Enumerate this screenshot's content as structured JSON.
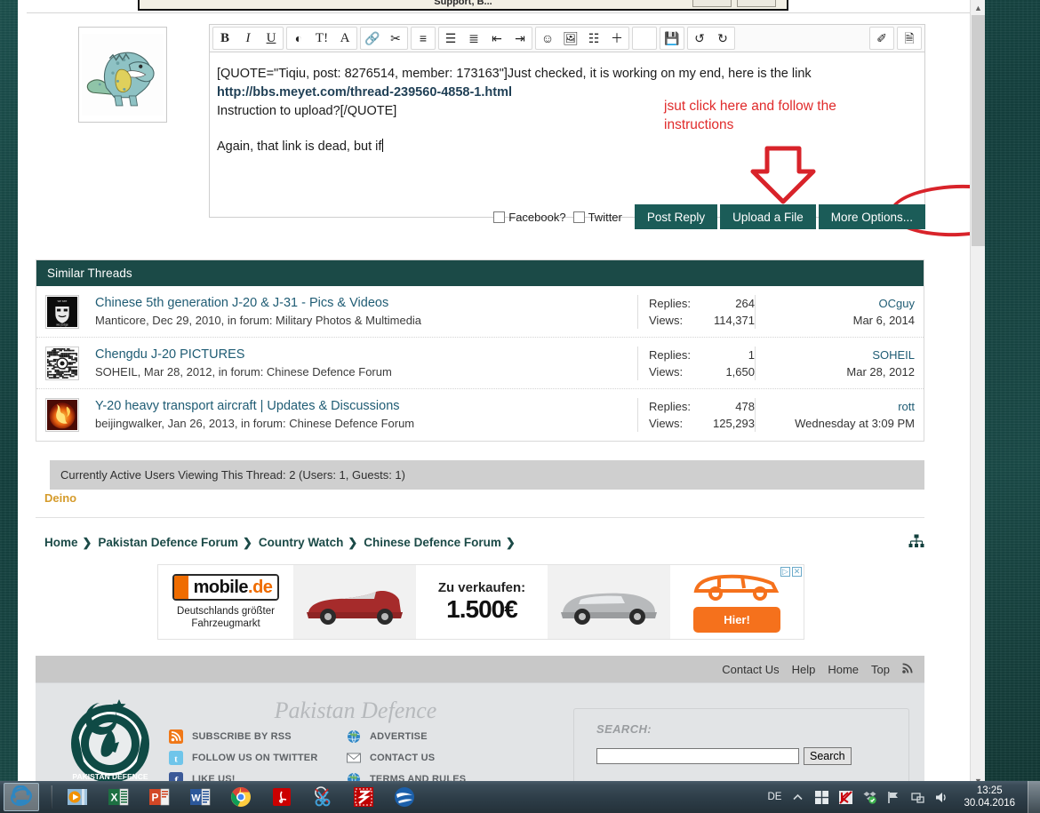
{
  "top_dialog": {
    "title": "Support, B..."
  },
  "editor": {
    "toolbar_groups": [
      {
        "buttons": [
          {
            "name": "bold-icon",
            "glyph": "B",
            "style": "b-bold"
          },
          {
            "name": "italic-icon",
            "glyph": "I",
            "style": "b-ital"
          },
          {
            "name": "underline-icon",
            "glyph": "U",
            "style": "b-under"
          }
        ]
      },
      {
        "buttons": [
          {
            "name": "text-color-icon",
            "glyph": "◐",
            "style": ""
          },
          {
            "name": "font-size-icon",
            "glyph": "T!",
            "style": "b-serif"
          },
          {
            "name": "font-family-icon",
            "glyph": "A",
            "style": "b-serif"
          }
        ]
      },
      {
        "buttons": [
          {
            "name": "insert-link-icon",
            "glyph": "🔗",
            "style": ""
          },
          {
            "name": "unlink-icon",
            "glyph": "✂",
            "style": ""
          }
        ]
      },
      {
        "buttons": [
          {
            "name": "align-icon",
            "glyph": "≡",
            "style": ""
          }
        ]
      },
      {
        "buttons": [
          {
            "name": "bullet-list-icon",
            "glyph": "☰",
            "style": ""
          },
          {
            "name": "numbered-list-icon",
            "glyph": "≣",
            "style": ""
          },
          {
            "name": "outdent-icon",
            "glyph": "⇤",
            "style": ""
          },
          {
            "name": "indent-icon",
            "glyph": "⇥",
            "style": ""
          }
        ]
      },
      {
        "buttons": [
          {
            "name": "smilie-icon",
            "glyph": "☺",
            "style": ""
          },
          {
            "name": "insert-image-icon",
            "glyph": "🖼",
            "style": ""
          },
          {
            "name": "insert-media-icon",
            "glyph": "☷",
            "style": ""
          },
          {
            "name": "more-tools-icon",
            "glyph": "＋",
            "style": ""
          }
        ]
      },
      {
        "empty": true
      },
      {
        "buttons": [
          {
            "name": "save-draft-icon",
            "glyph": "💾",
            "style": ""
          }
        ]
      },
      {
        "buttons": [
          {
            "name": "undo-icon",
            "glyph": "↺",
            "style": ""
          },
          {
            "name": "redo-icon",
            "glyph": "↻",
            "style": ""
          }
        ]
      }
    ],
    "toolbar_right": [
      {
        "buttons": [
          {
            "name": "remove-formatting-icon",
            "glyph": "✐",
            "style": ""
          }
        ]
      },
      {
        "buttons": [
          {
            "name": "toggle-bbcode-icon",
            "glyph": "🗎",
            "style": ""
          }
        ]
      }
    ],
    "content": {
      "line1": "[QUOTE=\"Tiqiu, post: 8276514, member: 173163\"]Just checked, it is working on my end, here is the link",
      "line2": "http://bbs.meyet.com/thread-239560-4858-1.html",
      "line3": "Instruction to upload?[/QUOTE]",
      "line4": "Again, that link is dead, but if"
    },
    "annotation": {
      "text": "jsut click here and follow the instructions",
      "color": "#e02b2b"
    },
    "footer": {
      "facebook_label": "Facebook?",
      "twitter_label": "Twitter",
      "post_reply_label": "Post Reply",
      "upload_file_label": "Upload a File",
      "more_options_label": "More Options..."
    }
  },
  "similar_threads": {
    "header": "Similar Threads",
    "labels": {
      "replies": "Replies:",
      "views": "Views:"
    },
    "rows": [
      {
        "avatar": "anonymous-mask-avatar",
        "title": "Chinese 5th generation J-20 & J-31 - Pics & Videos",
        "meta": "Manticore, Dec 29, 2010, in forum: Military Photos & Multimedia",
        "replies": "264",
        "views": "114,371",
        "last_user": "OCguy",
        "last_date": "Mar 6, 2014"
      },
      {
        "avatar": "qr-code-avatar",
        "title": "Chengdu J-20 PICTURES",
        "meta": "SOHEIL, Mar 28, 2012, in forum: Chinese Defence Forum",
        "replies": "1",
        "views": "1,650",
        "last_user": "SOHEIL",
        "last_date": "Mar 28, 2012"
      },
      {
        "avatar": "dragon-avatar",
        "title": "Y-20 heavy transport aircraft | Updates & Discussions",
        "meta": "beijingwalker, Jan 26, 2013, in forum: Chinese Defence Forum",
        "replies": "478",
        "views": "125,293",
        "last_user": "rott",
        "last_date": "Wednesday at 3:09 PM"
      }
    ]
  },
  "active_users": {
    "bar_text": "Currently Active Users Viewing This Thread: 2 (Users: 1, Guests: 1)",
    "user": "Deino"
  },
  "breadcrumb": {
    "items": [
      "Home",
      "Pakistan Defence Forum",
      "Country Watch",
      "Chinese Defence Forum"
    ],
    "separator": "❯"
  },
  "ad": {
    "logo_text": "mobile",
    "logo_suffix": ".de",
    "subtitle_line1": "Deutschlands größter",
    "subtitle_line2": "Fahrzeugmarkt",
    "price_label": "Zu verkaufen:",
    "price_value": "1.500€",
    "cta_label": "Hier!",
    "badge_info": "▷",
    "badge_close": "✕"
  },
  "footer_nav": {
    "links": [
      "Contact Us",
      "Help",
      "Home",
      "Top"
    ],
    "rss_glyph": "ᴧ"
  },
  "footer": {
    "site_title": "Pakistan Defence",
    "col1": [
      {
        "icon": "rss-icon",
        "label": "SUBSCRIBE BY RSS"
      },
      {
        "icon": "twitter-icon",
        "label": "FOLLOW US ON TWITTER"
      },
      {
        "icon": "facebook-icon",
        "label": "LIKE US!"
      }
    ],
    "col2": [
      {
        "icon": "globe-icon",
        "label": "ADVERTISE"
      },
      {
        "icon": "envelope-icon",
        "label": "CONTACT US"
      },
      {
        "icon": "globe-icon",
        "label": "TERMS AND RULES"
      }
    ],
    "search": {
      "label": "SEARCH:",
      "value": "",
      "placeholder": "",
      "button": "Search"
    }
  },
  "taskbar": {
    "apps": [
      "internet-explorer-icon",
      "media-player-icon",
      "excel-icon",
      "powerpoint-icon",
      "word-icon",
      "chrome-icon",
      "adobe-reader-icon",
      "snipping-tool-icon",
      "filezilla-icon",
      "google-earth-icon"
    ],
    "tray": {
      "language": "DE",
      "icons": [
        "show-hidden-icons",
        "windows-icon",
        "kaspersky-icon",
        "dropbox-icon",
        "flag-icon",
        "network-icon",
        "volume-icon"
      ],
      "time": "13:25",
      "date": "30.04.2016"
    }
  },
  "colors": {
    "accent_teal": "#1b5c58",
    "header_teal": "#1b4a47",
    "link_blue": "#1f5c74",
    "annotation_red": "#d8232a",
    "ad_orange": "#ef6c00"
  }
}
